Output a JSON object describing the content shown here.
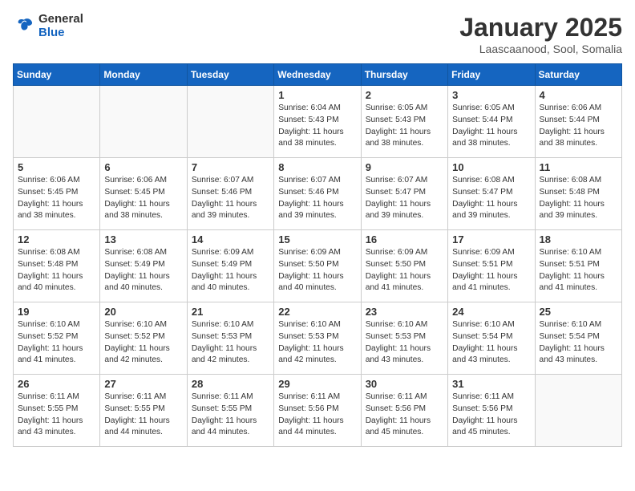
{
  "logo": {
    "general": "General",
    "blue": "Blue"
  },
  "header": {
    "title": "January 2025",
    "subtitle": "Laascaanood, Sool, Somalia"
  },
  "weekdays": [
    "Sunday",
    "Monday",
    "Tuesday",
    "Wednesday",
    "Thursday",
    "Friday",
    "Saturday"
  ],
  "weeks": [
    [
      {
        "day": "",
        "info": ""
      },
      {
        "day": "",
        "info": ""
      },
      {
        "day": "",
        "info": ""
      },
      {
        "day": "1",
        "info": "Sunrise: 6:04 AM\nSunset: 5:43 PM\nDaylight: 11 hours\nand 38 minutes."
      },
      {
        "day": "2",
        "info": "Sunrise: 6:05 AM\nSunset: 5:43 PM\nDaylight: 11 hours\nand 38 minutes."
      },
      {
        "day": "3",
        "info": "Sunrise: 6:05 AM\nSunset: 5:44 PM\nDaylight: 11 hours\nand 38 minutes."
      },
      {
        "day": "4",
        "info": "Sunrise: 6:06 AM\nSunset: 5:44 PM\nDaylight: 11 hours\nand 38 minutes."
      }
    ],
    [
      {
        "day": "5",
        "info": "Sunrise: 6:06 AM\nSunset: 5:45 PM\nDaylight: 11 hours\nand 38 minutes."
      },
      {
        "day": "6",
        "info": "Sunrise: 6:06 AM\nSunset: 5:45 PM\nDaylight: 11 hours\nand 38 minutes."
      },
      {
        "day": "7",
        "info": "Sunrise: 6:07 AM\nSunset: 5:46 PM\nDaylight: 11 hours\nand 39 minutes."
      },
      {
        "day": "8",
        "info": "Sunrise: 6:07 AM\nSunset: 5:46 PM\nDaylight: 11 hours\nand 39 minutes."
      },
      {
        "day": "9",
        "info": "Sunrise: 6:07 AM\nSunset: 5:47 PM\nDaylight: 11 hours\nand 39 minutes."
      },
      {
        "day": "10",
        "info": "Sunrise: 6:08 AM\nSunset: 5:47 PM\nDaylight: 11 hours\nand 39 minutes."
      },
      {
        "day": "11",
        "info": "Sunrise: 6:08 AM\nSunset: 5:48 PM\nDaylight: 11 hours\nand 39 minutes."
      }
    ],
    [
      {
        "day": "12",
        "info": "Sunrise: 6:08 AM\nSunset: 5:48 PM\nDaylight: 11 hours\nand 40 minutes."
      },
      {
        "day": "13",
        "info": "Sunrise: 6:08 AM\nSunset: 5:49 PM\nDaylight: 11 hours\nand 40 minutes."
      },
      {
        "day": "14",
        "info": "Sunrise: 6:09 AM\nSunset: 5:49 PM\nDaylight: 11 hours\nand 40 minutes."
      },
      {
        "day": "15",
        "info": "Sunrise: 6:09 AM\nSunset: 5:50 PM\nDaylight: 11 hours\nand 40 minutes."
      },
      {
        "day": "16",
        "info": "Sunrise: 6:09 AM\nSunset: 5:50 PM\nDaylight: 11 hours\nand 41 minutes."
      },
      {
        "day": "17",
        "info": "Sunrise: 6:09 AM\nSunset: 5:51 PM\nDaylight: 11 hours\nand 41 minutes."
      },
      {
        "day": "18",
        "info": "Sunrise: 6:10 AM\nSunset: 5:51 PM\nDaylight: 11 hours\nand 41 minutes."
      }
    ],
    [
      {
        "day": "19",
        "info": "Sunrise: 6:10 AM\nSunset: 5:52 PM\nDaylight: 11 hours\nand 41 minutes."
      },
      {
        "day": "20",
        "info": "Sunrise: 6:10 AM\nSunset: 5:52 PM\nDaylight: 11 hours\nand 42 minutes."
      },
      {
        "day": "21",
        "info": "Sunrise: 6:10 AM\nSunset: 5:53 PM\nDaylight: 11 hours\nand 42 minutes."
      },
      {
        "day": "22",
        "info": "Sunrise: 6:10 AM\nSunset: 5:53 PM\nDaylight: 11 hours\nand 42 minutes."
      },
      {
        "day": "23",
        "info": "Sunrise: 6:10 AM\nSunset: 5:53 PM\nDaylight: 11 hours\nand 43 minutes."
      },
      {
        "day": "24",
        "info": "Sunrise: 6:10 AM\nSunset: 5:54 PM\nDaylight: 11 hours\nand 43 minutes."
      },
      {
        "day": "25",
        "info": "Sunrise: 6:10 AM\nSunset: 5:54 PM\nDaylight: 11 hours\nand 43 minutes."
      }
    ],
    [
      {
        "day": "26",
        "info": "Sunrise: 6:11 AM\nSunset: 5:55 PM\nDaylight: 11 hours\nand 43 minutes."
      },
      {
        "day": "27",
        "info": "Sunrise: 6:11 AM\nSunset: 5:55 PM\nDaylight: 11 hours\nand 44 minutes."
      },
      {
        "day": "28",
        "info": "Sunrise: 6:11 AM\nSunset: 5:55 PM\nDaylight: 11 hours\nand 44 minutes."
      },
      {
        "day": "29",
        "info": "Sunrise: 6:11 AM\nSunset: 5:56 PM\nDaylight: 11 hours\nand 44 minutes."
      },
      {
        "day": "30",
        "info": "Sunrise: 6:11 AM\nSunset: 5:56 PM\nDaylight: 11 hours\nand 45 minutes."
      },
      {
        "day": "31",
        "info": "Sunrise: 6:11 AM\nSunset: 5:56 PM\nDaylight: 11 hours\nand 45 minutes."
      },
      {
        "day": "",
        "info": ""
      }
    ]
  ]
}
